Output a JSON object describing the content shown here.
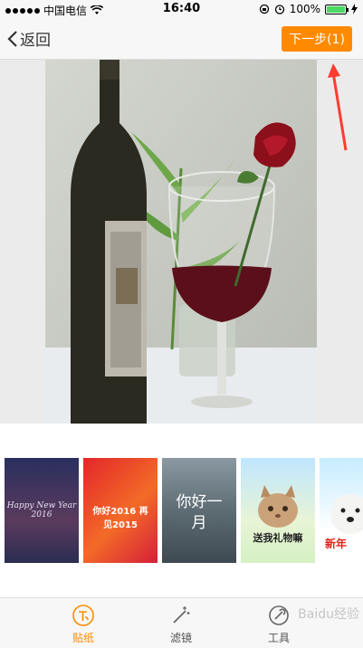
{
  "status_bar": {
    "carrier": "中国电信",
    "time": "16:40",
    "battery": "100%",
    "battery_level": 1.0
  },
  "nav": {
    "back_label": "返回",
    "next_label": "下一步(1)"
  },
  "stickers": {
    "items": [
      {
        "caption": "Happy New Year 2016"
      },
      {
        "caption": "你好2016 再见2015"
      },
      {
        "caption": "你好一月"
      },
      {
        "caption": "送我礼物嘛"
      },
      {
        "caption": "新年"
      }
    ]
  },
  "tabs": [
    {
      "label": "贴纸",
      "active": true
    },
    {
      "label": "滤镜",
      "active": false
    },
    {
      "label": "工具",
      "active": false
    }
  ],
  "colors": {
    "accent": "#ff8a00",
    "annotation": "#ff3b30"
  },
  "watermark": "Baidu经验"
}
